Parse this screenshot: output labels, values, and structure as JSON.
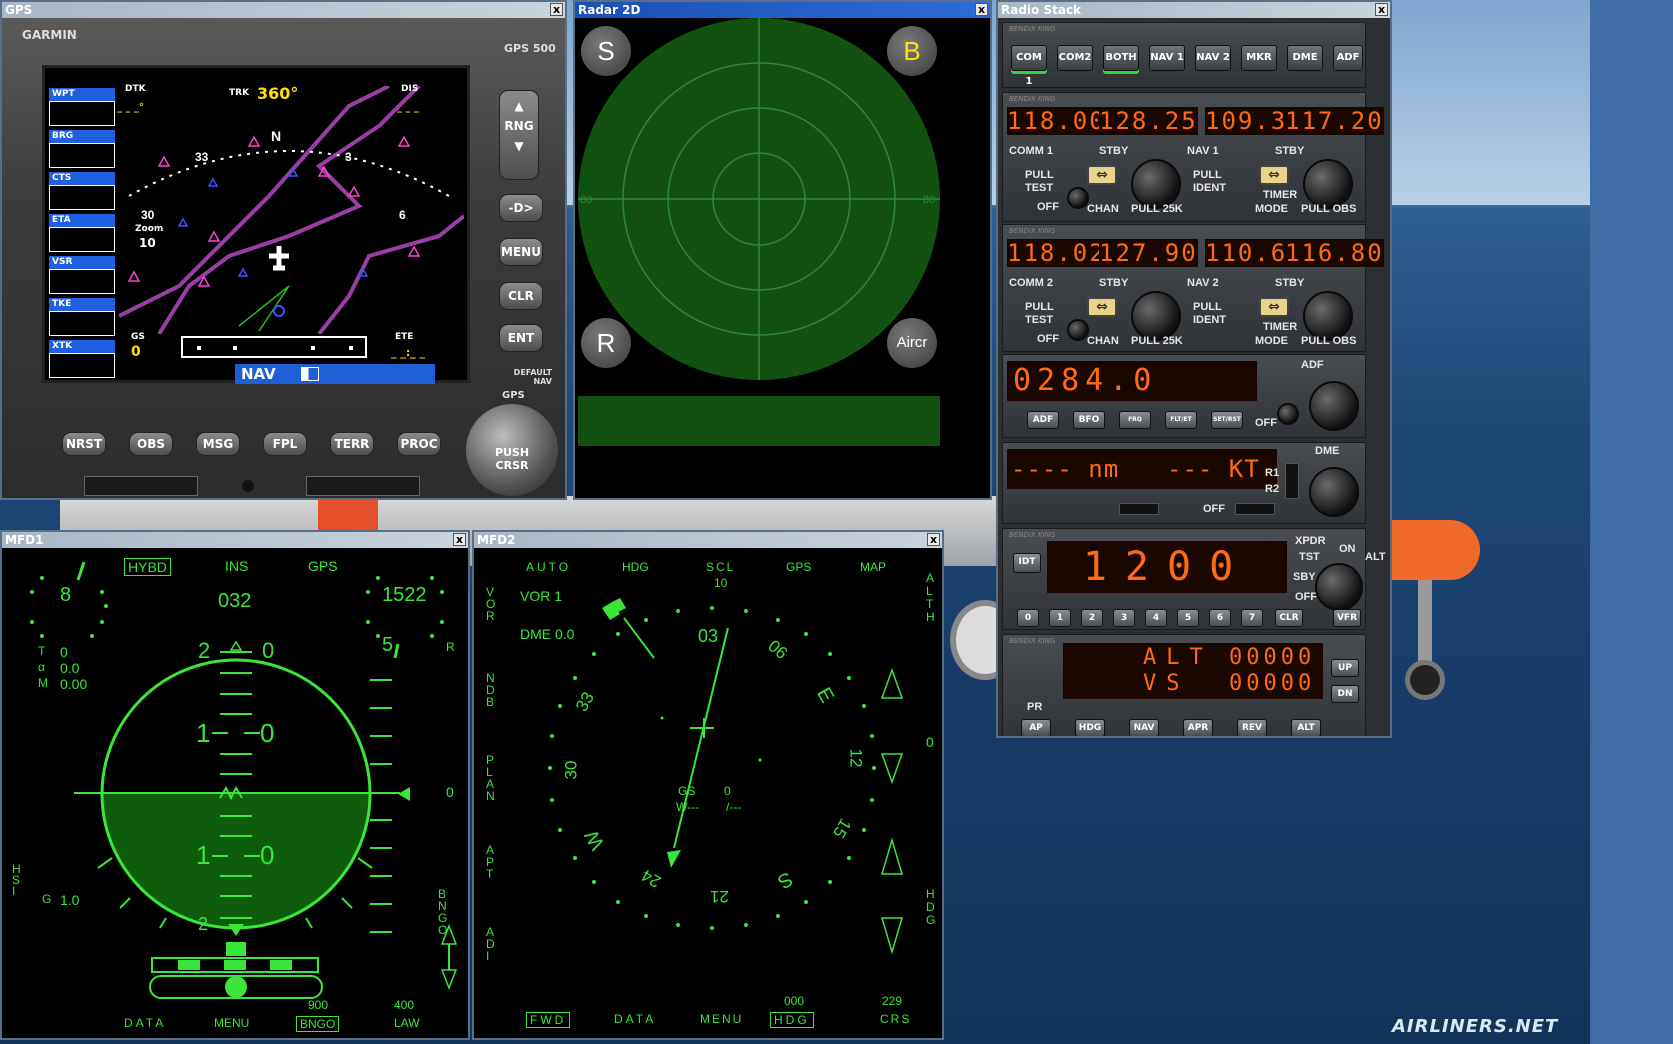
{
  "background": {
    "watermark": "AIRLINERS.NET"
  },
  "windows": {
    "gps": {
      "title": "GPS",
      "close": "x"
    },
    "radar": {
      "title": "Radar 2D",
      "close": "x"
    },
    "radio": {
      "title": "Radio Stack",
      "close": "x"
    },
    "mfd1": {
      "title": "MFD1",
      "close": "x"
    },
    "mfd2": {
      "title": "MFD2",
      "close": "x"
    }
  },
  "gps": {
    "brand": "GARMIN",
    "model": "GPS 500",
    "fields": [
      {
        "label": "WPT"
      },
      {
        "label": "BRG"
      },
      {
        "label": "CTS"
      },
      {
        "label": "ETA"
      },
      {
        "label": "VSR"
      },
      {
        "label": "TKE"
      },
      {
        "label": "XTK"
      }
    ],
    "dtk_label": "DTK",
    "dtk_value": "_ _ _°",
    "trk_label": "TRK",
    "trk_value": "360°",
    "dis_label": "DIS",
    "dis_value": "_ _ _",
    "compass": {
      "n": "N",
      "l30": "30",
      "l33": "33",
      "l3": "3",
      "l6": "6"
    },
    "zoom_label": "Zoom",
    "zoom_value": "10",
    "gs_label": "GS",
    "gs_value": "0",
    "ete_label": "ETE",
    "ete_value": "_ _:_ _",
    "mode": "NAV",
    "buttons": {
      "rng": "RNG",
      "direct": "-D>",
      "menu": "MENU",
      "clr": "CLR",
      "ent": "ENT",
      "default_nav": "DEFAULT NAV",
      "gps": "GPS",
      "push_crsr": "PUSH CRSR",
      "nrst": "NRST",
      "obs": "OBS",
      "msg": "MSG",
      "fpl": "FPL",
      "terr": "TERR",
      "proc": "PROC"
    }
  },
  "radar": {
    "btn_s": "S",
    "btn_b": "B",
    "btn_r": "R",
    "btn_aircr": "Aircr",
    "range_left": "80",
    "range_right": "80"
  },
  "radio": {
    "brand": "BENDIX KING",
    "audio": [
      "COM 1",
      "COM2",
      "BOTH",
      "NAV 1",
      "NAV 2",
      "MKR",
      "DME",
      "ADF"
    ],
    "com1": {
      "active": "118.00",
      "standby": "128.25",
      "label": "COMM 1",
      "stby": "STBY",
      "pull_test": "PULL TEST",
      "off": "OFF",
      "chan": "CHAN",
      "pull25": "PULL 25K"
    },
    "nav1": {
      "active": "109.30",
      "standby": "117.20",
      "label": "NAV 1",
      "stby": "STBY",
      "pull_ident": "PULL IDENT",
      "timer": "TIMER",
      "mode": "MODE",
      "pull_obs": "PULL OBS"
    },
    "com2": {
      "active": "118.02",
      "standby": "127.90",
      "label": "COMM 2",
      "stby": "STBY",
      "pull_test": "PULL TEST",
      "off": "OFF",
      "chan": "CHAN",
      "pull25": "PULL 25K"
    },
    "nav2": {
      "active": "110.60",
      "standby": "116.80",
      "label": "NAV 2",
      "stby": "STBY",
      "pull_ident": "PULL IDENT",
      "timer": "TIMER",
      "mode": "MODE",
      "pull_obs": "PULL OBS"
    },
    "adf": {
      "freq": "0284.0",
      "label": "ADF",
      "buttons": [
        "ADF",
        "BFO",
        "FRQ",
        "FLT/ET",
        "SET/RST"
      ],
      "off": "OFF"
    },
    "dme": {
      "dist": "---- nm",
      "speed": "--- KT",
      "label": "DME",
      "r1": "R1",
      "r2": "R2",
      "off": "OFF"
    },
    "xpdr": {
      "code": "1200",
      "label": "XPDR",
      "idt": "IDT",
      "tst": "TST",
      "on": "ON",
      "alt": "ALT",
      "sby": "SBY",
      "off": "OFF",
      "digits": [
        "0",
        "1",
        "2",
        "3",
        "4",
        "5",
        "6",
        "7"
      ],
      "clr": "CLR",
      "vfr": "VFR"
    },
    "ap": {
      "alt_label": "ALT",
      "alt_value": "00000",
      "vs_label": "VS",
      "vs_value": "00000",
      "up": "UP",
      "dn": "DN",
      "pr": "PR",
      "buttons": [
        "AP",
        "HDG",
        "NAV",
        "APR",
        "REV",
        "ALT"
      ]
    }
  },
  "mfd1": {
    "tabs": {
      "hybd": "HYBD",
      "ins": "INS",
      "gps": "GPS"
    },
    "speed": "8",
    "altitude": "1522",
    "heading": "032",
    "alt_tick": "5",
    "t_label": "T",
    "t_value": "0",
    "a_label": "α",
    "a_value": "0.0",
    "m_label": "M",
    "m_value": "0.00",
    "r_label": "R",
    "zero_right": "0",
    "pitch": {
      "p20": "2",
      "p20b": "0",
      "p10": "1",
      "p10b": "0",
      "m10": "1",
      "m10b": "0",
      "m20": "2"
    },
    "hsi": "HSI",
    "g_label": "G",
    "g_value": "1.0",
    "bngo_side": "BNGO",
    "bottom": {
      "data": "DATA",
      "menu": "MENU",
      "v900": "900",
      "bngo": "BNGO",
      "v400": "400",
      "law": "LAW"
    }
  },
  "mfd2": {
    "tabs": {
      "auto": "AUTO",
      "hdg": "HDG",
      "scl": "SCL",
      "scl_value": "10",
      "gps": "GPS",
      "map": "MAP"
    },
    "vor": "VOR 1",
    "dme": "DME 0.0",
    "left_side": [
      "V O R",
      "N D B",
      "P L A N",
      "A P T",
      "A D I"
    ],
    "right_side": [
      "A L T H",
      "H D G"
    ],
    "right_zero": "0",
    "compass": {
      "c03": "03",
      "c06": "06",
      "e": "E",
      "c12": "12",
      "c15": "15",
      "s": "S",
      "c21": "21",
      "c24": "24",
      "w": "W",
      "c30": "30",
      "c33": "33"
    },
    "gs_label": "GS",
    "gs_value": "0",
    "wind": "W---",
    "wind2": "/---",
    "bottom": {
      "fwd": "FWD",
      "data": "DATA",
      "menu": "MENU",
      "hdg_value": "000",
      "hdg": "HDG",
      "crs_value": "229",
      "crs": "CRS"
    }
  }
}
